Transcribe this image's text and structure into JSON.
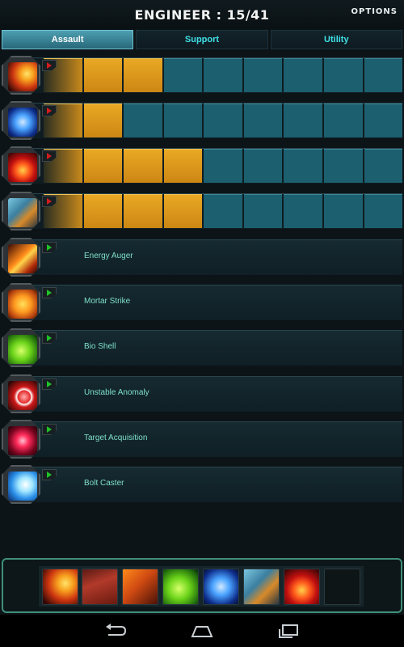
{
  "header": {
    "title": "ENGINEER : 15/41",
    "options_label": "OPTIONS"
  },
  "tabs": [
    {
      "label": "Assault",
      "active": true
    },
    {
      "label": "Support",
      "active": false
    },
    {
      "label": "Utility",
      "active": false
    }
  ],
  "skills": [
    {
      "icon": "fireball-icon",
      "status": "upgraded",
      "level": 3,
      "max_level": 9,
      "name": ""
    },
    {
      "icon": "skeleton-shock-icon",
      "status": "upgraded",
      "level": 2,
      "max_level": 9,
      "name": ""
    },
    {
      "icon": "fire-burst-icon",
      "status": "upgraded",
      "level": 4,
      "max_level": 9,
      "name": ""
    },
    {
      "icon": "mech-turret-icon",
      "status": "upgraded",
      "level": 4,
      "max_level": 9,
      "name": ""
    },
    {
      "icon": "energy-auger-icon",
      "status": "available",
      "level": 0,
      "max_level": 9,
      "name": "Energy Auger"
    },
    {
      "icon": "mortar-strike-icon",
      "status": "available",
      "level": 0,
      "max_level": 9,
      "name": "Mortar Strike"
    },
    {
      "icon": "bio-shell-icon",
      "status": "available",
      "level": 0,
      "max_level": 9,
      "name": "Bio Shell"
    },
    {
      "icon": "unstable-anomaly-icon",
      "status": "available",
      "level": 0,
      "max_level": 9,
      "name": "Unstable Anomaly"
    },
    {
      "icon": "target-acquisition-icon",
      "status": "available",
      "level": 0,
      "max_level": 9,
      "name": "Target Acquisition"
    },
    {
      "icon": "bolt-caster-icon",
      "status": "available",
      "level": 0,
      "max_level": 9,
      "name": "Bolt Caster"
    }
  ],
  "hotbar": {
    "slots": [
      "fireball-icon",
      "walker-mech-icon",
      "cannon-icon",
      "bio-shell-icon",
      "skeleton-shock-icon",
      "mech-turret-icon",
      "fire-burst-icon",
      "empty-slot"
    ]
  },
  "navbar": {
    "buttons": [
      "back-icon",
      "home-icon",
      "recent-apps-icon"
    ]
  },
  "colors": {
    "filled_segment": "#e9a824",
    "empty_segment": "#1c5f6f",
    "active_tab": "#4d9fb1",
    "tab_text": "#3fe0e6",
    "skill_name": "#7fe0ca",
    "upgraded_arrow": "#d11c1c",
    "available_arrow": "#1fc227"
  }
}
